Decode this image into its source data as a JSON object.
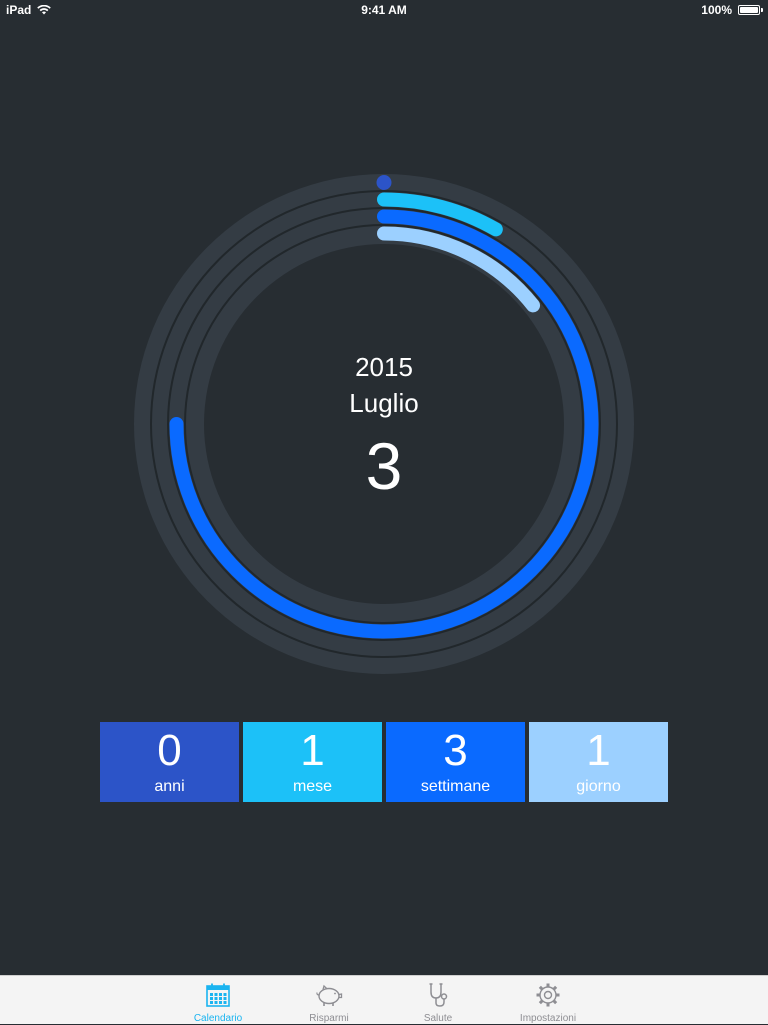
{
  "status_bar": {
    "device": "iPad",
    "time": "9:41 AM",
    "battery": "100%",
    "battery_level": 1.0
  },
  "center": {
    "year": "2015",
    "month": "Luglio",
    "day": "3"
  },
  "rings": [
    {
      "name": "anni",
      "color": "#2c54c8",
      "fraction": 0.0
    },
    {
      "name": "mese",
      "color": "#1cc1f8",
      "fraction": 0.083
    },
    {
      "name": "settimane",
      "color": "#0a6aff",
      "fraction": 0.75
    },
    {
      "name": "giorno",
      "color": "#9cd0ff",
      "fraction": 0.143
    }
  ],
  "colors": {
    "background": "#272d32",
    "track": "#343c44",
    "active_tab": "#1ab4f0",
    "inactive_tab": "#8e8e93"
  },
  "stats": [
    {
      "value": "0",
      "label": "anni",
      "color": "#2c54c8"
    },
    {
      "value": "1",
      "label": "mese",
      "color": "#1cc1f8"
    },
    {
      "value": "3",
      "label": "settimane",
      "color": "#0a6aff"
    },
    {
      "value": "1",
      "label": "giorno",
      "color": "#9cd0ff"
    }
  ],
  "tabs": [
    {
      "label": "Calendario",
      "icon": "calendar-icon",
      "active": true
    },
    {
      "label": "Risparmi",
      "icon": "piggy-bank-icon",
      "active": false
    },
    {
      "label": "Salute",
      "icon": "stethoscope-icon",
      "active": false
    },
    {
      "label": "Impostazioni",
      "icon": "gear-icon",
      "active": false
    }
  ]
}
